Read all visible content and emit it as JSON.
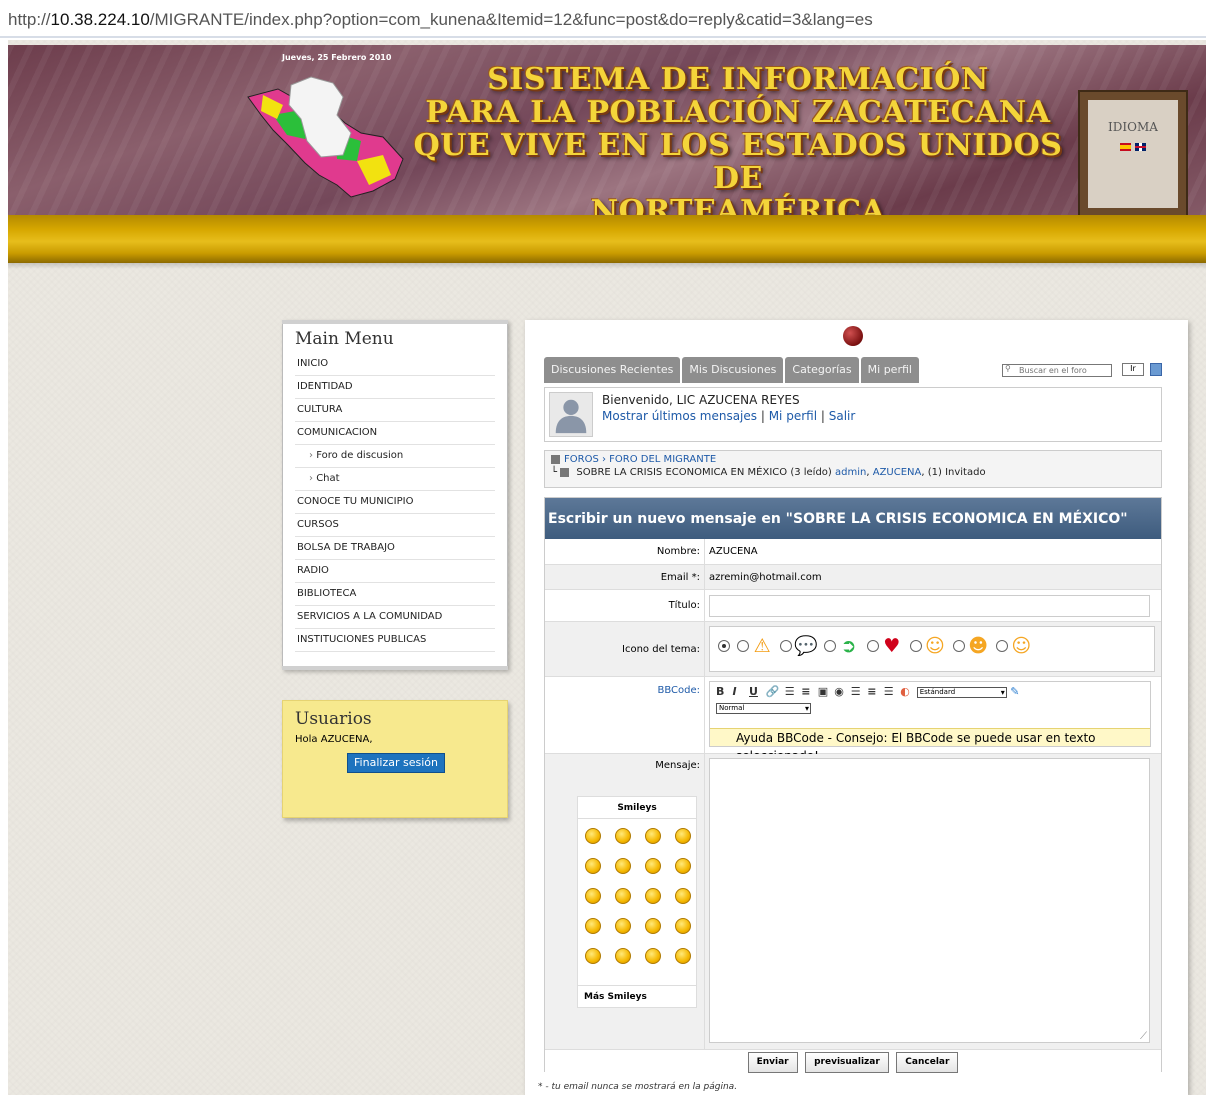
{
  "browser": {
    "url_prefix": "http://",
    "url_host": "10.38.224.10",
    "url_path": "/MIGRANTE/index.php?option=com_kunena&Itemid=12&func=post&do=reply&catid=3&lang=es"
  },
  "header": {
    "date": "Jueves, 25 Febrero 2010",
    "title_lines": [
      "SISTEMA DE INFORMACIÓN",
      "PARA LA POBLACIÓN ZACATECANA",
      "QUE VIVE EN LOS ESTADOS UNIDOS DE",
      "NORTEAMÉRICA"
    ],
    "language_box_label": "IDIOMA",
    "title_color": "#f4d53a"
  },
  "main_menu": {
    "title": "Main Menu",
    "items": [
      {
        "label": "INICIO"
      },
      {
        "label": "IDENTIDAD"
      },
      {
        "label": "CULTURA"
      },
      {
        "label": "COMUNICACION"
      },
      {
        "label": "Foro de discusion"
      },
      {
        "label": "Chat"
      },
      {
        "label": "CONOCE TU MUNICIPIO"
      },
      {
        "label": "CURSOS"
      },
      {
        "label": "BOLSA DE TRABAJO"
      },
      {
        "label": "RADIO"
      },
      {
        "label": "BIBLIOTECA"
      },
      {
        "label": "SERVICIOS A LA COMUNIDAD"
      },
      {
        "label": "INSTITUCIONES PUBLICAS"
      }
    ]
  },
  "users_box": {
    "title": "Usuarios",
    "greeting": "Hola AZUCENA,",
    "logout_label": "Finalizar sesión"
  },
  "forum": {
    "tabs": [
      "Discusiones Recientes",
      "Mis Discusiones",
      "Categorías",
      "Mi perfil"
    ],
    "search": {
      "placeholder": "Buscar en el foro",
      "go_label": "Ir"
    },
    "welcome": {
      "text": "Bienvenido, LIC AZUCENA REYES",
      "link_messages": "Mostrar últimos mensajes",
      "link_profile": "Mi perfil",
      "link_logout": "Salir"
    },
    "breadcrumb": {
      "root": "FOROS",
      "category": "FORO DEL MIGRANTE",
      "topic": "SOBRE LA CRISIS ECONOMICA EN MÉXICO",
      "views": "(3 leído)",
      "author1": "admin",
      "author2": "AZUCENA",
      "guests": "(1) Invitado"
    },
    "form": {
      "heading": "Escribir un nuevo mensaje en \"SOBRE LA CRISIS ECONOMICA EN MÉXICO\"",
      "name_label": "Nombre:",
      "name_value": "AZUCENA",
      "email_label": "Email *:",
      "email_value": "azremin@hotmail.com",
      "title_label": "Título:",
      "icon_label": "Icono del tema:",
      "bbcode_label": "BBCode:",
      "bb_font_select": "Estándard",
      "bb_size_select": "Normal",
      "bb_help": "Ayuda BBCode - Consejo: El BBCode se puede usar en texto seleccionado!",
      "message_label": "Mensaje:",
      "smileys_label": "Smileys",
      "more_smileys_label": "Más Smileys",
      "submit_label": "Enviar",
      "preview_label": "previsualizar",
      "cancel_label": "Cancelar"
    },
    "footnote": "* - tu email nunca se mostrará en la página."
  }
}
